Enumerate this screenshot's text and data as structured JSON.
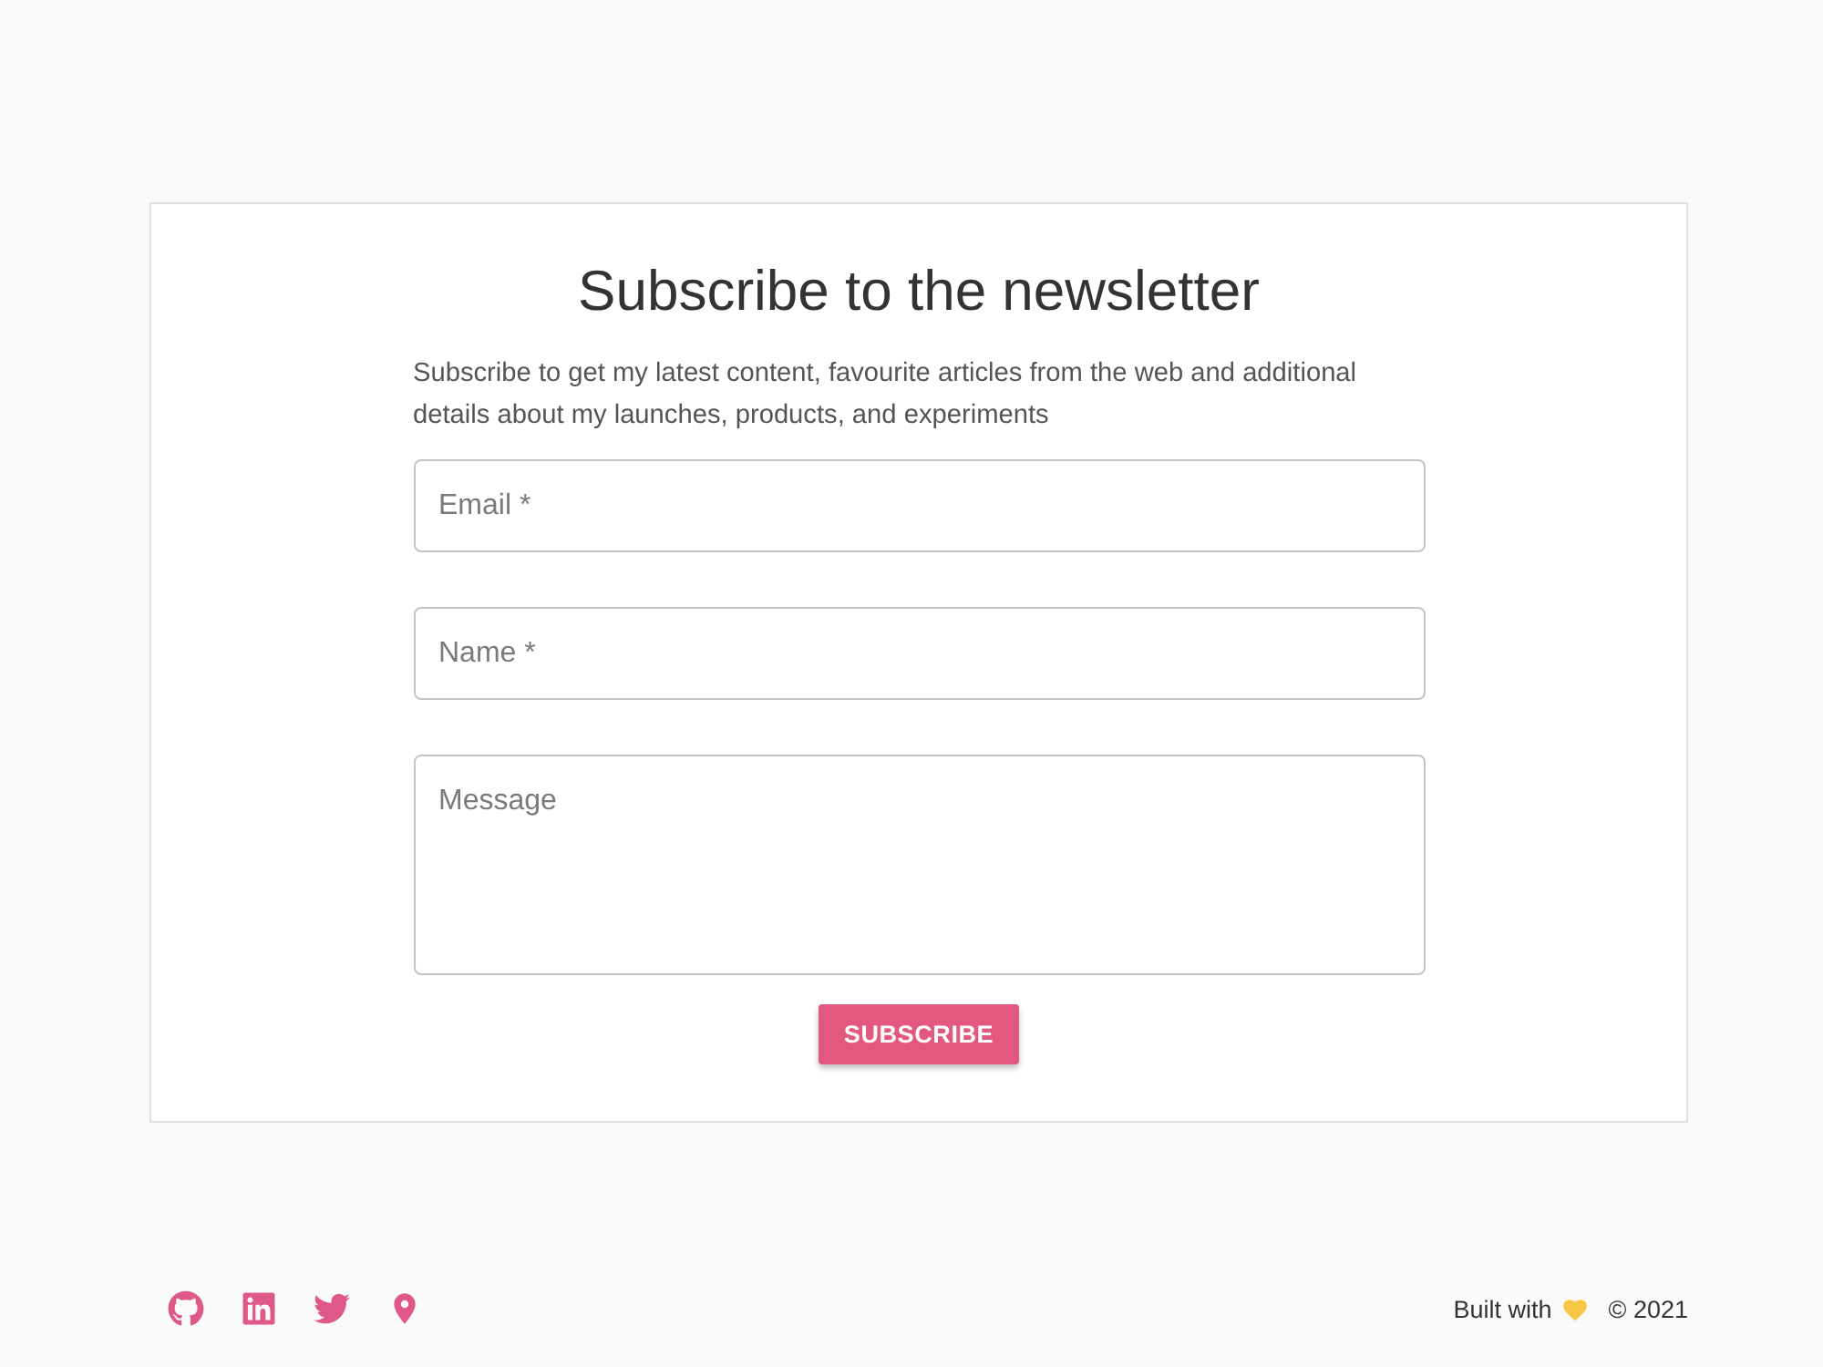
{
  "card": {
    "title": "Subscribe to the newsletter",
    "description": "Subscribe to get my latest content, favourite articles from the web and additional details about my launches, products, and experiments",
    "fields": [
      {
        "kind": "text",
        "placeholder": "Email *"
      },
      {
        "kind": "text",
        "placeholder": "Name *"
      },
      {
        "kind": "textarea",
        "placeholder": "Message"
      }
    ],
    "button": "SUBSCRIBE"
  },
  "footer": {
    "links": [
      {
        "kind": "github"
      },
      {
        "kind": "linkedin"
      },
      {
        "kind": "twitter"
      },
      {
        "kind": "location"
      }
    ],
    "credit": "Built with",
    "copyright": "© 2021"
  }
}
